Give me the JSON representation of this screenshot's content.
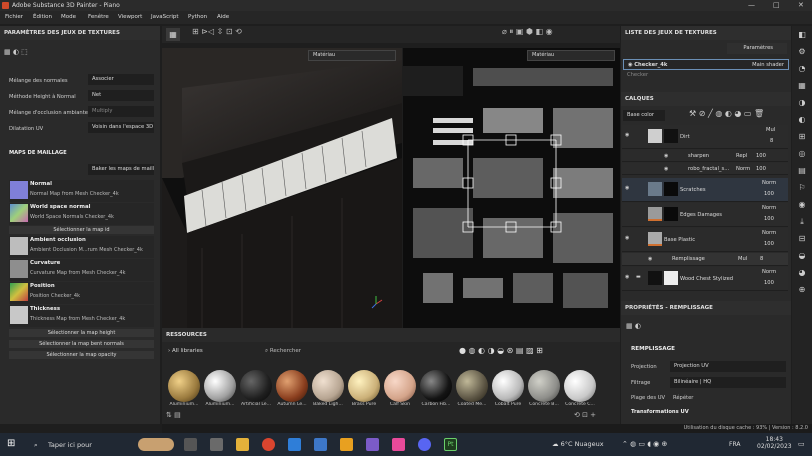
{
  "window": {
    "title": "Adobe Substance 3D Painter - Piano"
  },
  "menu": [
    "Fichier",
    "Édition",
    "Mode",
    "Fenêtre",
    "Viewport",
    "JavaScript",
    "Python",
    "Aide"
  ],
  "left": {
    "title": "PARAMÈTRES DES JEUX DE TEXTURES",
    "settings": [
      {
        "label": "Mélange des normales",
        "value": "Associer"
      },
      {
        "label": "Méthode Height à Normal",
        "value": "Net"
      },
      {
        "label": "Mélange d'occlusion ambiante",
        "value": "Multiply"
      },
      {
        "label": "Dilatation UV",
        "value": "Voisin dans l'espace 3D"
      }
    ],
    "maps_title": "MAPS DE MAILLAGE",
    "bake_button": "Baker les maps de maillage",
    "maps": [
      {
        "name": "Normal",
        "sub": "Normal Map from Mesh Checker_4k",
        "color": "#7f7fd8"
      },
      {
        "name": "World space normal",
        "sub": "World Space Normals Checker_4k",
        "color": "#6aa0c8"
      },
      {
        "name": "Ambient occlusion",
        "sub": "Ambient Occlusion M...rum Mesh Checker_4k",
        "color": "#bdbdbd"
      },
      {
        "name": "Curvature",
        "sub": "Curvature Map from Mesh Checker_4k",
        "color": "#8e8e8e"
      },
      {
        "name": "Position",
        "sub": "Position Checker_4k",
        "color": "#3aa860"
      },
      {
        "name": "Thickness",
        "sub": "Thickness Map from Mesh Checker_4k",
        "color": "#c8c8c8"
      }
    ],
    "select_id": "Sélectionner la map id",
    "select_buttons": [
      "Sélectionner la map height",
      "Sélectionner la map bent normals",
      "Sélectionner la map opacity"
    ]
  },
  "viewport": {
    "left_mode": "Matériau",
    "right_mode": "Matériau"
  },
  "resources": {
    "title": "RESSOURCES",
    "library": "All libraries",
    "search_placeholder": "Rechercher",
    "items": [
      {
        "name": "Aluminium...",
        "color": "#9a7a3e"
      },
      {
        "name": "Aluminium...",
        "color": "#c7c7c7"
      },
      {
        "name": "Artificial Le...",
        "color": "#1f1f1f"
      },
      {
        "name": "Autumn Le...",
        "color": "#8a3e1e"
      },
      {
        "name": "Baked Ligh...",
        "color": "#b7a592"
      },
      {
        "name": "Brass Pure",
        "color": "#cbb078"
      },
      {
        "name": "Calf Skin",
        "color": "#d4a48a"
      },
      {
        "name": "Carbon Fib...",
        "color": "#141414"
      },
      {
        "name": "Coated Me...",
        "color": "#5c5544"
      },
      {
        "name": "Cobalt Pure",
        "color": "#b9b9b9"
      },
      {
        "name": "Concrete B...",
        "color": "#8e8e8a"
      },
      {
        "name": "Concrete C...",
        "color": "#c9c9c9"
      }
    ]
  },
  "right": {
    "texset_title": "LISTE DES JEUX DE TEXTURES",
    "params_btn": "Paramètres",
    "texsets": [
      {
        "name": "Checker_4k",
        "shader": "Main shader"
      },
      {
        "name": "Checker",
        "shader": ""
      }
    ],
    "layers_title": "CALQUES",
    "channel": "Base color",
    "layers": [
      {
        "name": "Dirt",
        "blend": "Mul",
        "opacity": "8"
      },
      {
        "name": "sharpen",
        "blend": "Repl",
        "opacity": "100"
      },
      {
        "name": "robo_fractal_s...",
        "blend": "Norm",
        "opacity": "100"
      },
      {
        "name": "Scratches",
        "blend": "Norm",
        "opacity": "100"
      },
      {
        "name": "Edges Damages",
        "blend": "Norm",
        "opacity": "100"
      },
      {
        "name": "Base Plastic",
        "blend": "Norm",
        "opacity": "100"
      },
      {
        "name": "Remplissage",
        "blend": "Mul",
        "opacity": "8"
      },
      {
        "name": "Wood Chest Stylized",
        "blend": "Norm",
        "opacity": "100"
      }
    ],
    "props_title": "PROPRIÉTÉS - REMPLISSAGE",
    "fill_title": "REMPLISSAGE",
    "props": [
      {
        "label": "Projection",
        "value": "Projection UV"
      },
      {
        "label": "Filtrage",
        "value": "Bilinéaire | HQ"
      },
      {
        "label": "Plage des UV",
        "value": "Répéter"
      }
    ],
    "transform": "Transformations UV"
  },
  "status": "Utilisation du disque cache : 93% | Version : 8.2.0",
  "taskbar": {
    "search": "Taper ici pour",
    "weather": "6°C Nuageux",
    "lang": "FRA",
    "time": "18:43",
    "date": "02/02/2023"
  }
}
